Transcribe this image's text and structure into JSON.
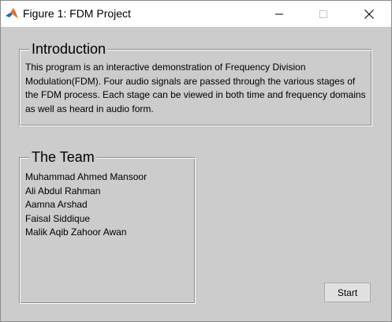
{
  "window": {
    "title": "Figure 1: FDM Project",
    "icon": "matlab-icon"
  },
  "title_buttons": {
    "minimize_icon": "minimize-icon",
    "maximize_icon": "maximize-icon",
    "close_icon": "close-icon"
  },
  "intro": {
    "title": "Introduction",
    "text": "This program is an interactive demonstration of Frequency Division Modulation(FDM). Four audio signals are passed through the various stages of the FDM process. Each stage can be viewed in both time and frequency domains as well as heard in audio form."
  },
  "team": {
    "title": "The Team",
    "members": [
      "Muhammad Ahmed Mansoor",
      "Ali Abdul Rahman",
      "Aamna Arshad",
      "Faisal Siddique",
      "Malik Aqib Zahoor Awan"
    ]
  },
  "start_button": {
    "label": "Start"
  },
  "colors": {
    "background": "#cccccc",
    "titlebar": "#ffffff",
    "button_face": "#e1e1e1"
  }
}
